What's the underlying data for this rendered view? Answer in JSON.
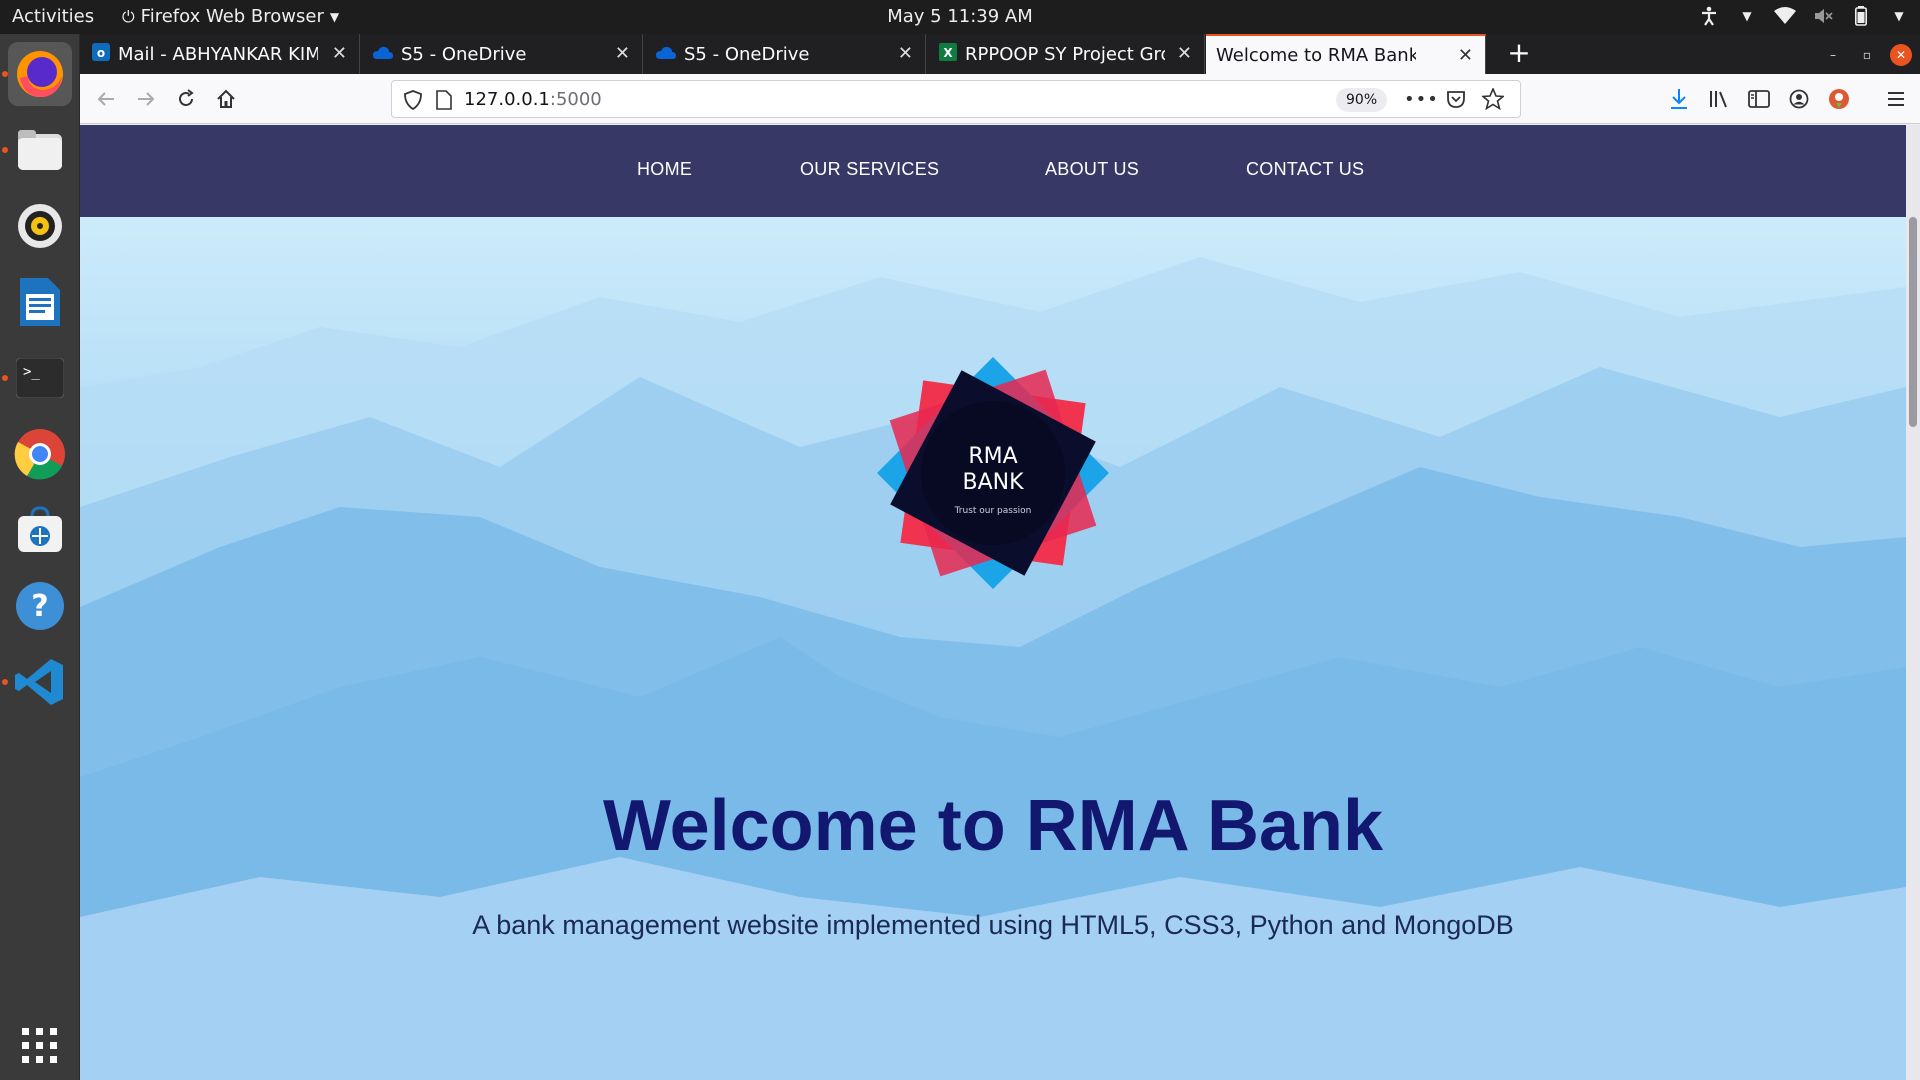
{
  "topbar": {
    "activities": "Activities",
    "app_name": "Firefox Web Browser",
    "clock": "May 5  11:39 AM"
  },
  "dock": {
    "items": [
      "firefox-icon",
      "files-icon",
      "rhythmbox-icon",
      "writer-icon",
      "terminal-icon",
      "chrome-icon",
      "software-icon",
      "help-icon",
      "vscode-icon",
      "app-grid-icon"
    ]
  },
  "browser": {
    "tabs": [
      {
        "label": "Mail - ABHYANKAR KIMAYA",
        "icon": "outlook-icon"
      },
      {
        "label": "S5 - OneDrive",
        "icon": "onedrive-icon"
      },
      {
        "label": "S5 - OneDrive",
        "icon": "onedrive-icon"
      },
      {
        "label": "RPPOOP SY Project Group",
        "icon": "excel-icon"
      },
      {
        "label": "Welcome to RMA Bank",
        "icon": ""
      }
    ],
    "url_host": "127.0.0.1",
    "url_port": ":5000",
    "zoom": "90%"
  },
  "site": {
    "nav": [
      "HOME",
      "OUR SERVICES",
      "ABOUT US",
      "CONTACT US"
    ],
    "logo_line1": "RMA",
    "logo_line2": "BANK",
    "logo_tagline": "Trust our passion",
    "heading": "Welcome to RMA Bank",
    "subtitle": "A bank management website implemented using HTML5, CSS3, Python and MongoDB"
  },
  "colors": {
    "nav_bg": "#383866",
    "heading": "#121870",
    "accent_tab": "#e95420"
  }
}
